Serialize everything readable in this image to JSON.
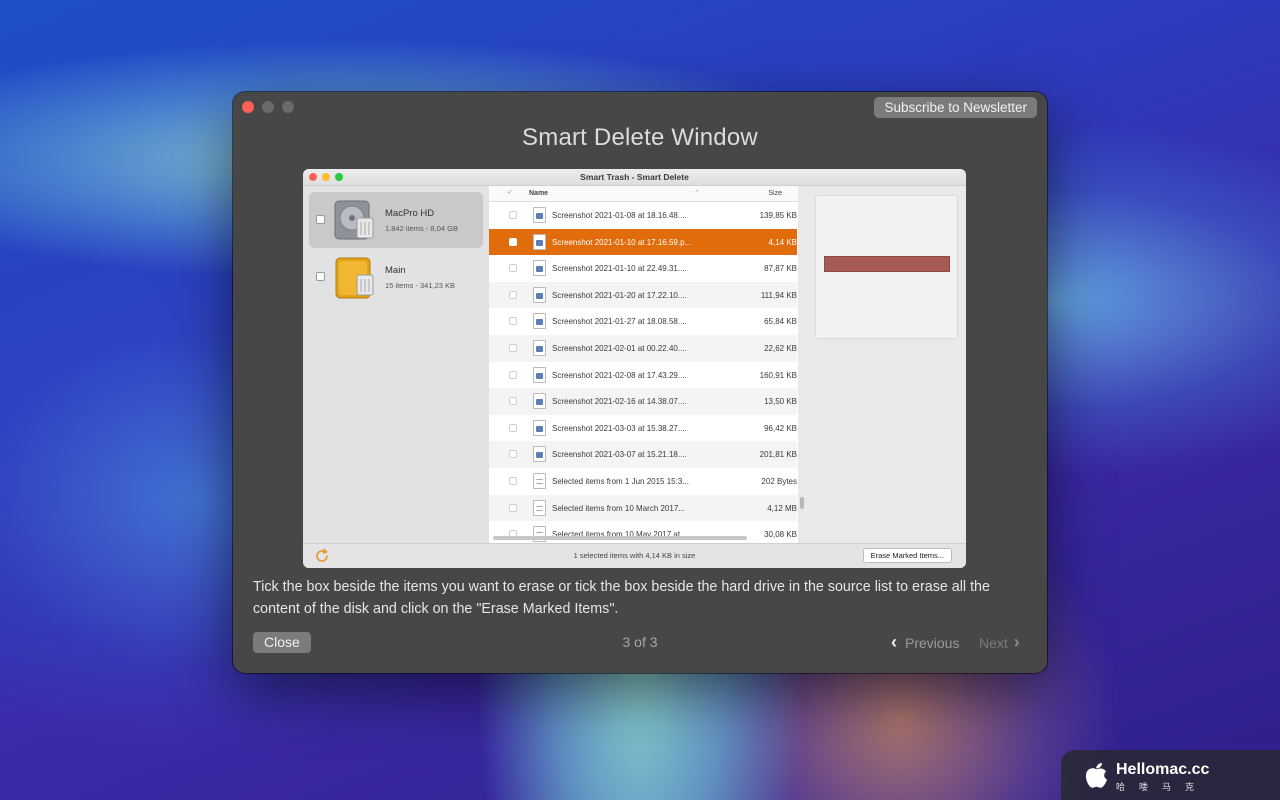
{
  "tour": {
    "subscribe_label": "Subscribe to Newsletter",
    "title": "Smart Delete Window",
    "description": "Tick the box beside the items you want to erase or tick the box beside the hard drive in the source list to erase all the content of the disk and click on the \"Erase Marked Items\".",
    "close_label": "Close",
    "pager": "3 of 3",
    "previous_label": "Previous",
    "next_label": "Next"
  },
  "inner_window": {
    "title": "Smart Trash - Smart Delete",
    "sources": [
      {
        "name": "MacPro HD",
        "sub": "1.842 items - 8,04 GB",
        "selected": true
      },
      {
        "name": "Main",
        "sub": "15 items - 341,23 KB",
        "selected": false
      }
    ],
    "columns": {
      "name": "Name",
      "size": "Size"
    },
    "files": [
      {
        "name": "Screenshot 2021-01-08 at 18.16.48....",
        "size": "139,85 KB",
        "type": "image",
        "selected": false
      },
      {
        "name": "Screenshot 2021-01-10 at 17.16.59.p...",
        "size": "4,14 KB",
        "type": "image",
        "selected": true
      },
      {
        "name": "Screenshot 2021-01-10 at 22.49.31....",
        "size": "87,87 KB",
        "type": "image",
        "selected": false
      },
      {
        "name": "Screenshot 2021-01-20 at 17.22.10....",
        "size": "111,94 KB",
        "type": "image",
        "selected": false
      },
      {
        "name": "Screenshot 2021-01-27 at 18.08.58....",
        "size": "65,84 KB",
        "type": "image",
        "selected": false
      },
      {
        "name": "Screenshot 2021-02-01 at 00.22.40....",
        "size": "22,62 KB",
        "type": "image",
        "selected": false
      },
      {
        "name": "Screenshot 2021-02-08 at 17.43.29....",
        "size": "160,91 KB",
        "type": "image",
        "selected": false
      },
      {
        "name": "Screenshot 2021-02-16 at 14.38.07....",
        "size": "13,50 KB",
        "type": "image",
        "selected": false
      },
      {
        "name": "Screenshot 2021-03-03 at 15.38.27....",
        "size": "96,42 KB",
        "type": "image",
        "selected": false
      },
      {
        "name": "Screenshot 2021-03-07 at 15.21.18....",
        "size": "201,81 KB",
        "type": "image",
        "selected": false
      },
      {
        "name": "Selected items from 1 Jun 2015 15:3...",
        "size": "202 Bytes",
        "type": "doc",
        "selected": false
      },
      {
        "name": "Selected items from 10 March 2017...",
        "size": "4,12 MB",
        "type": "doc",
        "selected": false
      },
      {
        "name": "Selected items from 10 May 2017 at...",
        "size": "30,08 KB",
        "type": "doc",
        "selected": false
      }
    ],
    "status": "1 selected items with 4,14 KB in size",
    "erase_label": "Erase Marked Items...",
    "selection_color": "#e06c0b"
  },
  "watermark": {
    "title": "Hellomac.cc",
    "subtitle": "哈喽马克"
  }
}
